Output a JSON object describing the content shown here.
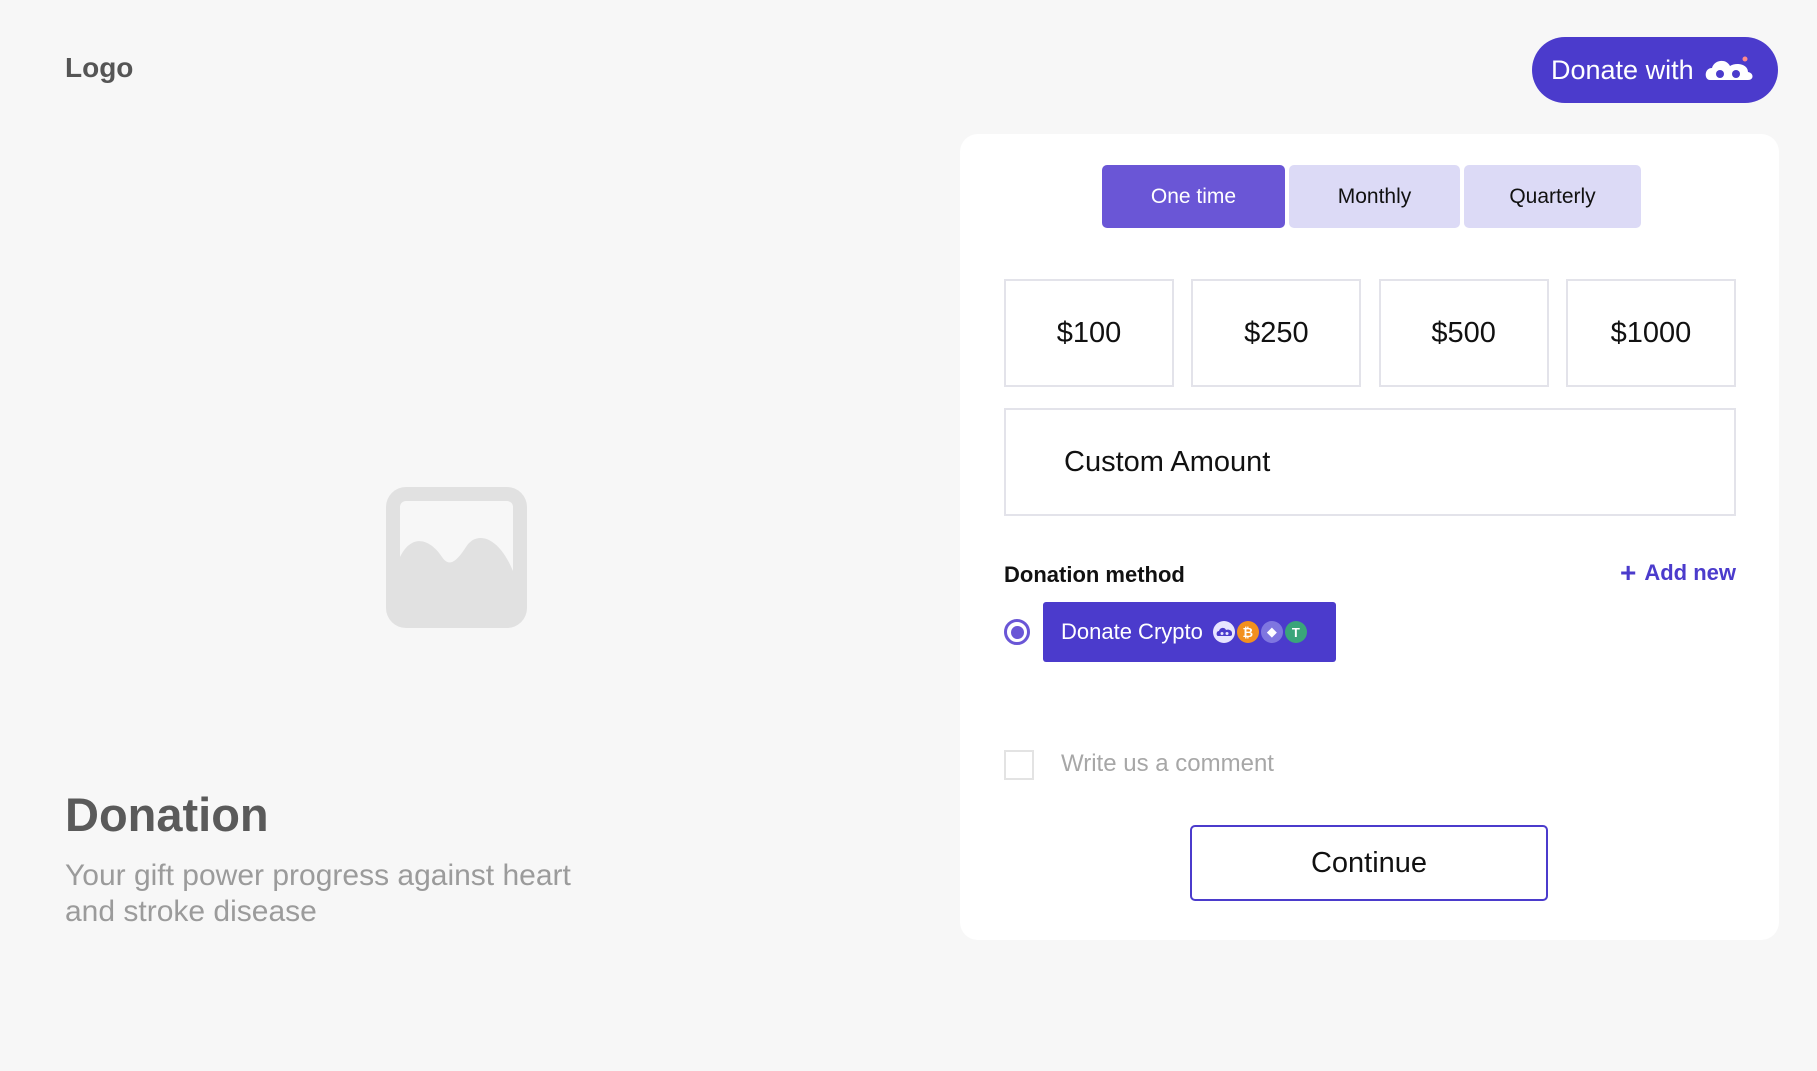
{
  "header": {
    "logo_text": "Logo",
    "donate_with_label": "Donate with"
  },
  "hero": {
    "title": "Donation",
    "subtitle": "Your gift power progress against heart and stroke disease"
  },
  "form": {
    "frequency_tabs": [
      {
        "label": "One time",
        "active": true
      },
      {
        "label": "Monthly",
        "active": false
      },
      {
        "label": "Quarterly",
        "active": false
      }
    ],
    "amounts": [
      "$100",
      "$250",
      "$500",
      "$1000"
    ],
    "custom_amount_label": "Custom Amount",
    "donation_method_label": "Donation method",
    "add_new_label": "Add new",
    "crypto_button_label": "Donate Crypto",
    "crypto_icons": [
      "brand-icon",
      "bitcoin-icon",
      "ethereum-icon",
      "tether-icon"
    ],
    "comment_label": "Write us a comment",
    "continue_label": "Continue"
  },
  "colors": {
    "accent": "#4b3bcc",
    "tab_active": "#6a56d6",
    "tab_inactive": "#dcdaf6",
    "background": "#f7f7f7"
  }
}
